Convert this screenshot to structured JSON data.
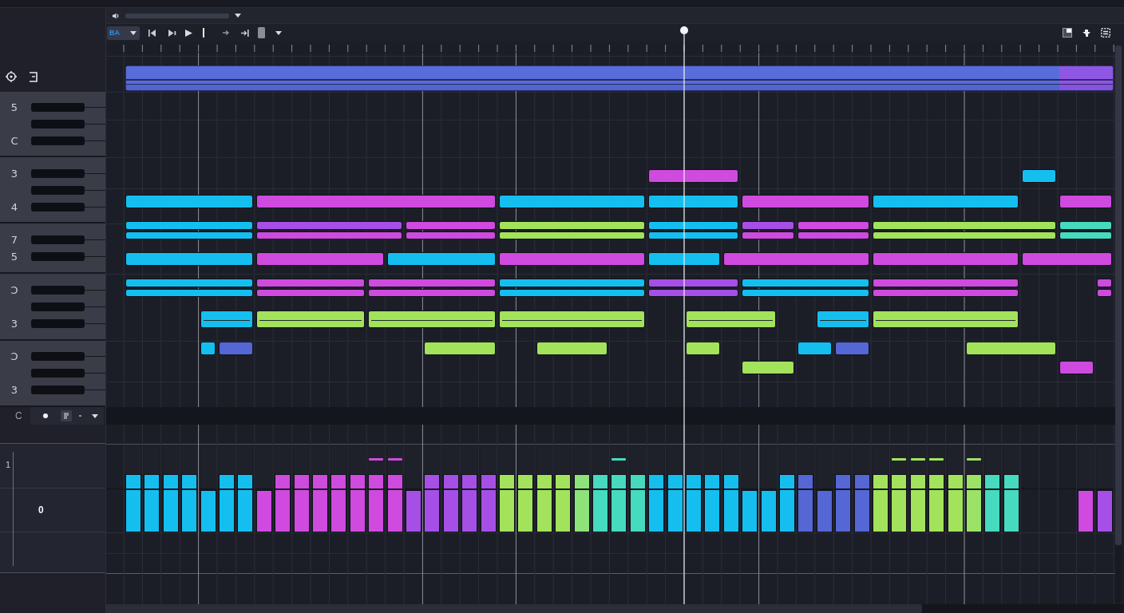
{
  "toolbar": {
    "snap": {
      "value": "BA"
    }
  },
  "keyboard": {
    "sections": [
      {
        "labels": [
          "5",
          "C"
        ]
      },
      {
        "labels": [
          "3",
          "4"
        ]
      },
      {
        "labels": [
          "7",
          "5"
        ]
      },
      {
        "labels": [
          "Ↄ",
          "3"
        ]
      },
      {
        "labels": [
          "Ↄ",
          "3"
        ]
      }
    ]
  },
  "note_lanes": [
    {
      "notes": [
        {
          "color": "#cf4ade"
        },
        {
          "color": "#14bff0"
        }
      ]
    },
    {
      "notes": [
        {
          "color": "#14bff0"
        },
        {
          "color": "#cf4ade"
        },
        {
          "color": "#14bff0"
        },
        {
          "color": "#14bff0"
        },
        {
          "color": "#cf4ade"
        },
        {
          "color": "#14bff0"
        },
        {
          "color": "#cf4ade"
        }
      ]
    },
    {
      "notes": [
        {
          "color": "#14bff0"
        },
        {
          "color": "#a64fe6"
        },
        {
          "color": "#cf4ade"
        },
        {
          "color": "#a2e35b"
        },
        {
          "color": "#14bff0"
        },
        {
          "color": "#a64fe6"
        },
        {
          "color": "#cf4ade"
        },
        {
          "color": "#a2e35b"
        },
        {
          "color": "#46dabf"
        }
      ]
    },
    {
      "notes": [
        {
          "color": "#14bff0"
        },
        {
          "color": "#cf4ade"
        },
        {
          "color": "#cf4ade"
        },
        {
          "color": "#a2e35b"
        },
        {
          "color": "#14bff0"
        },
        {
          "color": "#cf4ade"
        },
        {
          "color": "#cf4ade"
        },
        {
          "color": "#a2e35b"
        },
        {
          "color": "#46dabf"
        }
      ]
    },
    {
      "notes": [
        {
          "color": "#14bff0"
        },
        {
          "color": "#cf4ade"
        },
        {
          "color": "#14bff0"
        },
        {
          "color": "#cf4ade"
        },
        {
          "color": "#14bff0"
        },
        {
          "color": "#cf4ade"
        },
        {
          "color": "#cf4ade"
        },
        {
          "color": "#cf4ade"
        }
      ]
    },
    {
      "notes": [
        {
          "color": "#14bff0"
        },
        {
          "color": "#cf4ade"
        },
        {
          "color": "#cf4ade"
        },
        {
          "color": "#14bff0"
        },
        {
          "color": "#a64fe6"
        },
        {
          "color": "#14bff0"
        },
        {
          "color": "#cf4ade"
        },
        {
          "color": "#cf4ade"
        }
      ]
    },
    {
      "notes": [
        {
          "color": "#14bff0"
        },
        {
          "color": "#cf4ade"
        },
        {
          "color": "#cf4ade"
        },
        {
          "color": "#14bff0"
        },
        {
          "color": "#a64fe6"
        },
        {
          "color": "#14bff0"
        },
        {
          "color": "#cf4ade"
        },
        {
          "color": "#cf4ade"
        }
      ]
    },
    {
      "notes": [
        {
          "color": "#14bff0"
        },
        {
          "color": "#a2e35b"
        },
        {
          "color": "#a2e35b"
        },
        {
          "color": "#a2e35b"
        },
        {
          "color": "#a2e35b"
        },
        {
          "color": "#14bff0"
        },
        {
          "color": "#a2e35b"
        }
      ]
    },
    {
      "notes": [
        {
          "color": "#14bff0"
        },
        {
          "color": "#5567d4"
        },
        {
          "color": "#a2e35b"
        },
        {
          "color": "#a2e35b"
        },
        {
          "color": "#a2e35b"
        },
        {
          "color": "#14bff0"
        },
        {
          "color": "#5567d4"
        },
        {
          "color": "#a2e35b"
        }
      ]
    },
    {
      "notes": [
        {
          "color": "#a2e35b"
        },
        {
          "color": "#cf4ade"
        }
      ]
    }
  ],
  "controls": {
    "note": "C"
  },
  "velocity": {
    "top_label": "1",
    "mid_label": "0",
    "bars": [
      {
        "level": 0.66,
        "color": "#14bff0",
        "marked": false
      },
      {
        "level": 0.66,
        "color": "#14bff0",
        "marked": false
      },
      {
        "level": 0.66,
        "color": "#14bff0",
        "marked": false
      },
      {
        "level": 0.66,
        "color": "#14bff0",
        "marked": false
      },
      {
        "level": 0.48,
        "color": "#14bff0",
        "marked": false
      },
      {
        "level": 0.66,
        "color": "#14bff0",
        "marked": false
      },
      {
        "level": 0.66,
        "color": "#14bff0",
        "marked": false
      },
      {
        "level": 0.48,
        "color": "#cf4ade",
        "marked": false
      },
      {
        "level": 0.66,
        "color": "#cf4ade",
        "marked": false
      },
      {
        "level": 0.66,
        "color": "#cf4ade",
        "marked": false
      },
      {
        "level": 0.66,
        "color": "#cf4ade",
        "marked": false
      },
      {
        "level": 0.66,
        "color": "#cf4ade",
        "marked": false
      },
      {
        "level": 0.66,
        "color": "#cf4ade",
        "marked": false
      },
      {
        "level": 0.66,
        "color": "#cf4ade",
        "marked": true
      },
      {
        "level": 0.66,
        "color": "#cf4ade",
        "marked": true
      },
      {
        "level": 0.48,
        "color": "#a64fe6",
        "marked": false
      },
      {
        "level": 0.66,
        "color": "#a64fe6",
        "marked": false
      },
      {
        "level": 0.66,
        "color": "#a64fe6",
        "marked": false
      },
      {
        "level": 0.66,
        "color": "#a64fe6",
        "marked": false
      },
      {
        "level": 0.66,
        "color": "#a64fe6",
        "marked": false
      },
      {
        "level": 0.66,
        "color": "#a2e35b",
        "marked": false
      },
      {
        "level": 0.66,
        "color": "#a2e35b",
        "marked": false
      },
      {
        "level": 0.66,
        "color": "#a2e35b",
        "marked": false
      },
      {
        "level": 0.66,
        "color": "#a2e35b",
        "marked": false
      },
      {
        "level": 0.66,
        "color": "#8ee27a",
        "marked": false
      },
      {
        "level": 0.66,
        "color": "#46dabf",
        "marked": false
      },
      {
        "level": 0.66,
        "color": "#46dabf",
        "marked": true
      },
      {
        "level": 0.66,
        "color": "#46dabf",
        "marked": false
      },
      {
        "level": 0.66,
        "color": "#14bff0",
        "marked": false
      },
      {
        "level": 0.66,
        "color": "#14bff0",
        "marked": false
      },
      {
        "level": 0.66,
        "color": "#14bff0",
        "marked": false
      },
      {
        "level": 0.66,
        "color": "#14bff0",
        "marked": false
      },
      {
        "level": 0.66,
        "color": "#14bff0",
        "marked": false
      },
      {
        "level": 0.48,
        "color": "#14bff0",
        "marked": false
      },
      {
        "level": 0.48,
        "color": "#14bff0",
        "marked": false
      },
      {
        "level": 0.66,
        "color": "#14bff0",
        "marked": false
      },
      {
        "level": 0.66,
        "color": "#5567d4",
        "marked": false
      },
      {
        "level": 0.48,
        "color": "#5567d4",
        "marked": false
      },
      {
        "level": 0.66,
        "color": "#5567d4",
        "marked": false
      },
      {
        "level": 0.66,
        "color": "#5567d4",
        "marked": false
      },
      {
        "level": 0.66,
        "color": "#a2e35b",
        "marked": false
      },
      {
        "level": 0.66,
        "color": "#a2e35b",
        "marked": true
      },
      {
        "level": 0.66,
        "color": "#a2e35b",
        "marked": true
      },
      {
        "level": 0.66,
        "color": "#a2e35b",
        "marked": true
      },
      {
        "level": 0.66,
        "color": "#a2e35b",
        "marked": false
      },
      {
        "level": 0.66,
        "color": "#9be267",
        "marked": true
      },
      {
        "level": 0.66,
        "color": "#46dabf",
        "marked": false
      },
      {
        "level": 0.66,
        "color": "#46dabf",
        "marked": false
      },
      {
        "level": 0.48,
        "color": "#cf4ade",
        "marked": false
      },
      {
        "level": 0.48,
        "color": "#a64fe6",
        "marked": false
      }
    ]
  }
}
